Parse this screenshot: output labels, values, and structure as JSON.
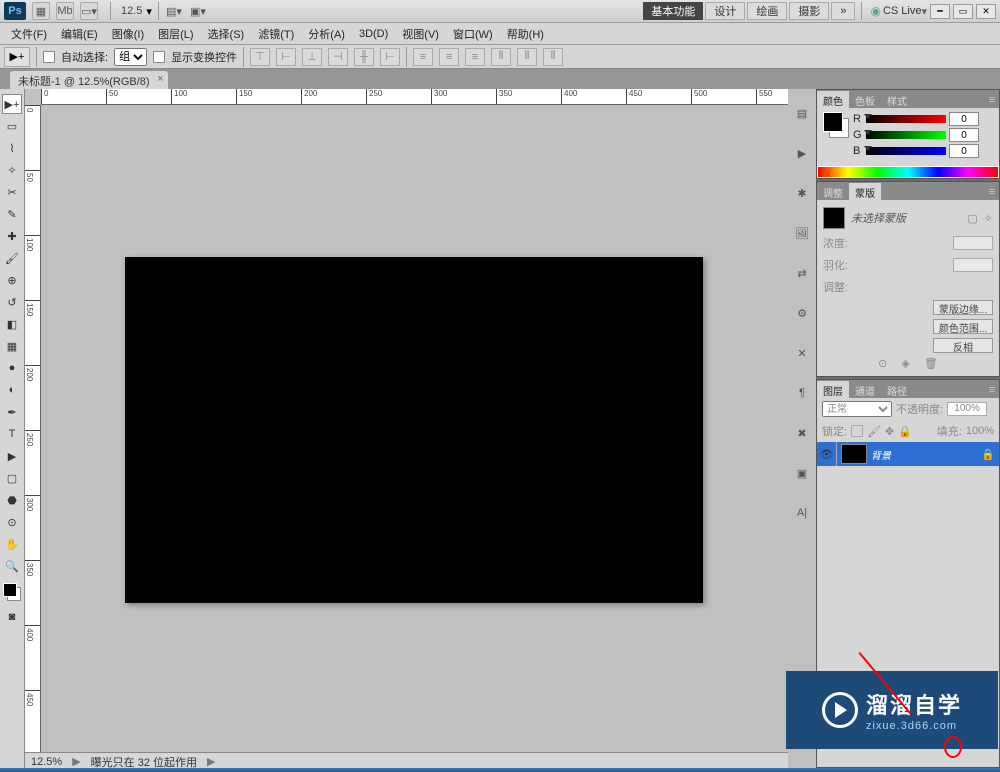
{
  "titlebar": {
    "ps": "Ps",
    "zoom": "12.5",
    "workspace_basic": "基本功能",
    "workspace_design": "设计",
    "workspace_paint": "绘画",
    "workspace_photo": "摄影",
    "more": "»",
    "cslive": "CS Live"
  },
  "menu": {
    "file": "文件(F)",
    "edit": "编辑(E)",
    "image": "图像(I)",
    "layer": "图层(L)",
    "select": "选择(S)",
    "filter": "滤镜(T)",
    "analysis": "分析(A)",
    "threed": "3D(D)",
    "view": "视图(V)",
    "window": "窗口(W)",
    "help": "帮助(H)"
  },
  "options": {
    "auto_select": "自动选择:",
    "group": "组",
    "show_transform": "显示变换控件"
  },
  "doctab": {
    "title": "未标题-1 @ 12.5%(RGB/8)"
  },
  "status": {
    "zoom": "12.5%",
    "msg": "曝光只在 32 位起作用"
  },
  "color_panel": {
    "tab_color": "颜色",
    "tab_swatch": "色板",
    "tab_style": "样式",
    "r": "R",
    "g": "G",
    "b": "B",
    "rv": "0",
    "gv": "0",
    "bv": "0"
  },
  "mask_panel": {
    "tab_adjust": "调整",
    "tab_mask": "蒙版",
    "no_mask": "未选择蒙版",
    "density": "浓度:",
    "feather": "羽化:",
    "adjust": "调整:",
    "mask_edge": "蒙版边缘...",
    "color_range": "颜色范围...",
    "invert": "反相"
  },
  "layers_panel": {
    "tab_layers": "图层",
    "tab_channels": "通道",
    "tab_paths": "路径",
    "blend": "正常",
    "opacity_lbl": "不透明度:",
    "opacity": "100%",
    "lock_lbl": "锁定:",
    "fill_lbl": "填充:",
    "fill": "100%",
    "layer_bg": "背景"
  },
  "watermark": {
    "big": "溜溜自学",
    "small": "zixue.3d66.com"
  },
  "ruler_h": [
    "0",
    "50",
    "100",
    "150",
    "200",
    "250",
    "300",
    "350",
    "400",
    "450",
    "500",
    "550"
  ],
  "ruler_v": [
    "0",
    "50",
    "100",
    "150",
    "200",
    "250",
    "300",
    "350",
    "400",
    "450"
  ]
}
